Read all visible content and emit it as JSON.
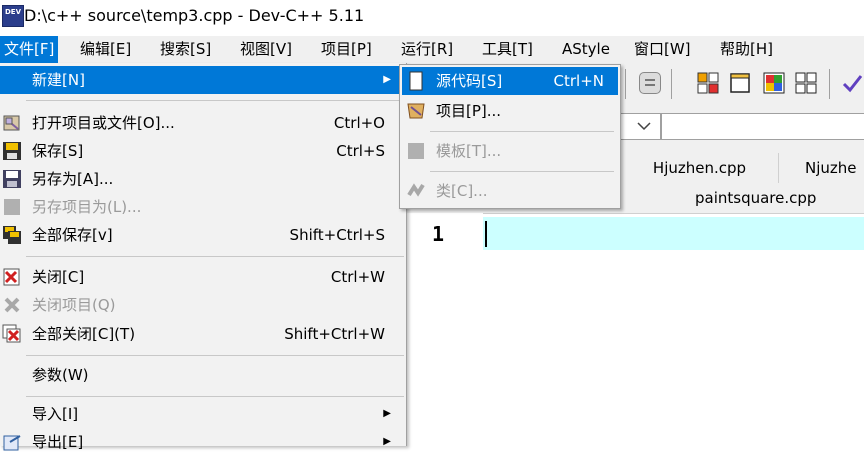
{
  "window": {
    "title": "D:\\c++ source\\temp3.cpp - Dev-C++ 5.11",
    "app_icon_text": "DEV"
  },
  "menubar": {
    "items": [
      {
        "label": "文件[F]",
        "active": true
      },
      {
        "label": "编辑[E]"
      },
      {
        "label": "搜索[S]"
      },
      {
        "label": "视图[V]"
      },
      {
        "label": "项目[P]"
      },
      {
        "label": "运行[R]"
      },
      {
        "label": "工具[T]"
      },
      {
        "label": "AStyle"
      },
      {
        "label": "窗口[W]"
      },
      {
        "label": "帮助[H]"
      }
    ]
  },
  "file_menu": {
    "items": [
      {
        "label": "新建[N]",
        "shortcut": "",
        "icon": "none",
        "highlighted": true,
        "submenu": true
      },
      {
        "label": "打开项目或文件[O]...",
        "shortcut": "Ctrl+O",
        "icon": "open-folder-icon"
      },
      {
        "label": "保存[S]",
        "shortcut": "Ctrl+S",
        "icon": "floppy-save-icon"
      },
      {
        "label": "另存为[A]...",
        "shortcut": "",
        "icon": "floppy-save-as-icon"
      },
      {
        "label": "另存项目为(L)...",
        "shortcut": "",
        "icon": "disabled-save-icon",
        "disabled": true
      },
      {
        "label": "全部保存[v]",
        "shortcut": "Shift+Ctrl+S",
        "icon": "save-all-icon"
      },
      {
        "label": "关闭[C]",
        "shortcut": "Ctrl+W",
        "icon": "close-file-icon"
      },
      {
        "label": "关闭项目(Q)",
        "shortcut": "",
        "icon": "close-project-icon",
        "disabled": true
      },
      {
        "label": "全部关闭[C](T)",
        "shortcut": "Shift+Ctrl+W",
        "icon": "close-all-icon"
      },
      {
        "label": "参数(W)",
        "shortcut": "",
        "icon": "none"
      },
      {
        "label": "导入[I]",
        "shortcut": "",
        "icon": "none",
        "submenu": true
      },
      {
        "label": "导出[E]",
        "shortcut": "",
        "icon": "export-icon",
        "submenu": true
      }
    ]
  },
  "new_submenu": {
    "items": [
      {
        "label": "源代码[S]",
        "shortcut": "Ctrl+N",
        "icon": "source-file-icon",
        "highlighted": true
      },
      {
        "label": "项目[P]...",
        "shortcut": "",
        "icon": "project-icon"
      },
      {
        "label": "模板[T]...",
        "shortcut": "",
        "icon": "template-icon",
        "disabled": true
      },
      {
        "label": "类[C]...",
        "shortcut": "",
        "icon": "class-icon",
        "disabled": true
      }
    ]
  },
  "editor_tabs": {
    "row1": [
      "Hjuzhen.cpp",
      "Njuzhe"
    ],
    "row2": [
      "paintsquare.cpp"
    ]
  },
  "editor": {
    "line_numbers": [
      "1"
    ]
  },
  "colors": {
    "accent": "#0078d7",
    "current_line": "#ccffff",
    "menu_bg": "#f0f0f0"
  }
}
